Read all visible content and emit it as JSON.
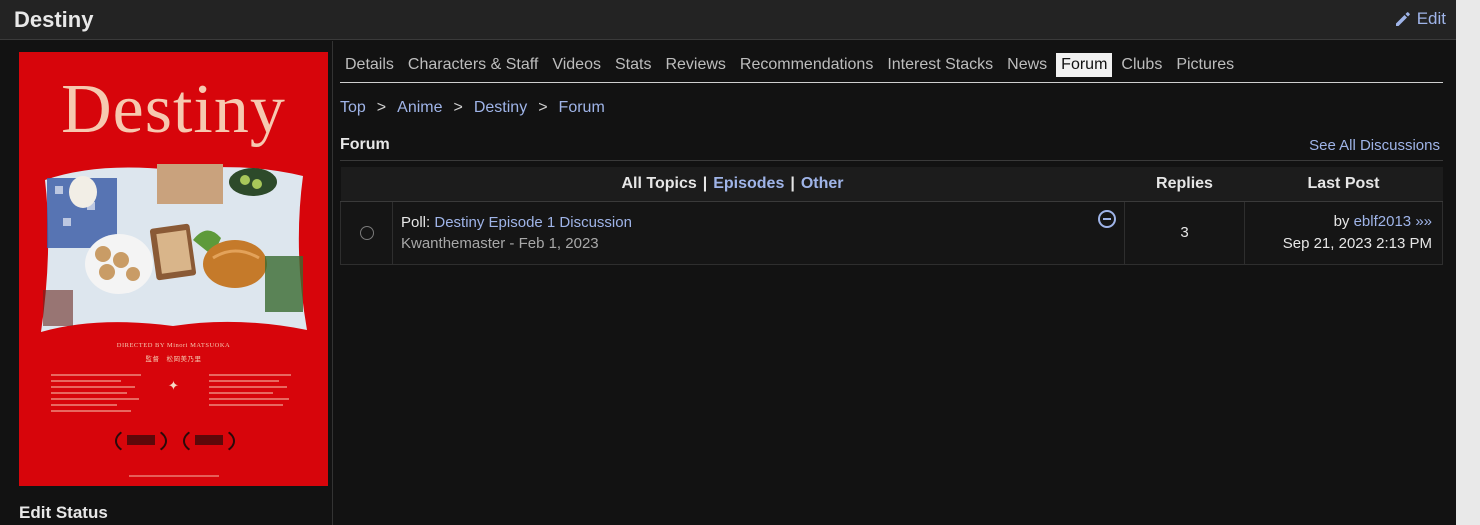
{
  "header": {
    "title": "Destiny",
    "edit_label": "Edit"
  },
  "sidebar": {
    "poster": {
      "title": "Destiny",
      "credit": "DIRECTED BY  Minori MATSUOKA",
      "credit_jp": "監督　松岡美乃里"
    },
    "edit_status_label": "Edit Status"
  },
  "tabs": [
    "Details",
    "Characters & Staff",
    "Videos",
    "Stats",
    "Reviews",
    "Recommendations",
    "Interest Stacks",
    "News",
    "Forum",
    "Clubs",
    "Pictures"
  ],
  "active_tab": "Forum",
  "breadcrumb": [
    "Top",
    "Anime",
    "Destiny",
    "Forum"
  ],
  "breadcrumb_sep": ">",
  "forum": {
    "title": "Forum",
    "see_all": "See All Discussions",
    "filter": {
      "all": "All Topics",
      "episodes": "Episodes",
      "other": "Other",
      "sep": "|"
    },
    "col_replies": "Replies",
    "col_last_post": "Last Post",
    "topics": [
      {
        "prefix": "Poll:",
        "title": "Destiny Episode 1 Discussion",
        "author": "Kwanthemaster",
        "date": "Feb 1, 2023",
        "replies": "3",
        "last_by_prefix": "by",
        "last_by": "eblf2013",
        "last_arrow": "»»",
        "last_date": "Sep 21, 2023 2:13 PM"
      }
    ]
  },
  "colors": {
    "accent_link": "#9fb4e8",
    "poster_red": "#d7050b",
    "background": "#121212"
  }
}
